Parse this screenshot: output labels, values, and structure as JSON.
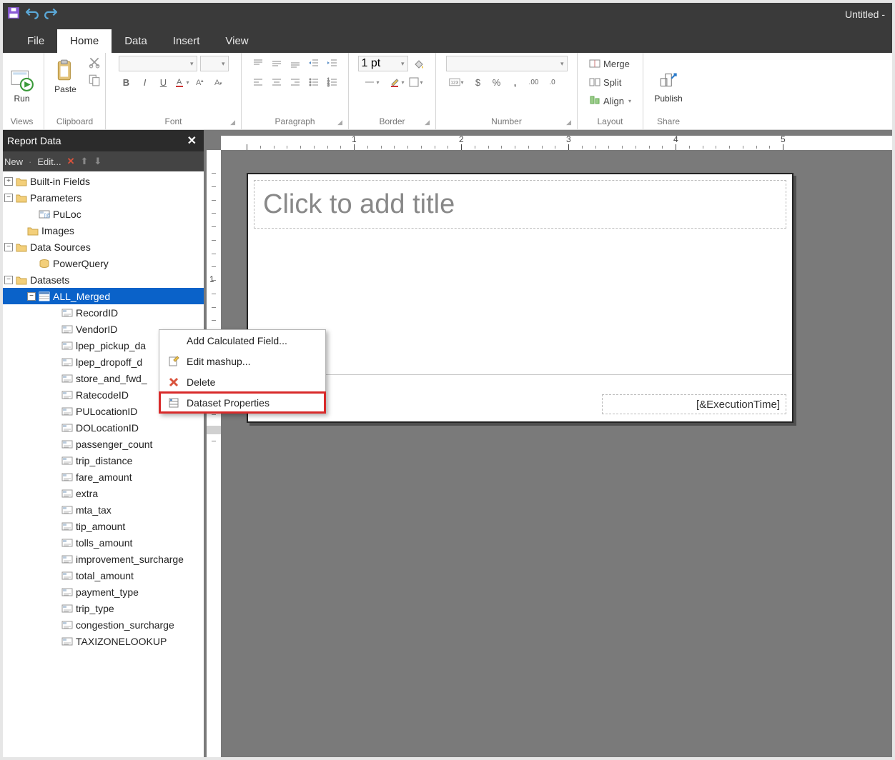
{
  "window": {
    "title": "Untitled -"
  },
  "qat": {
    "save": "save-icon",
    "undo": "undo-icon",
    "redo": "redo-icon"
  },
  "tabs": [
    "File",
    "Home",
    "Data",
    "Insert",
    "View"
  ],
  "active_tab_index": 1,
  "ribbon": {
    "views": {
      "run": "Run",
      "label": "Views"
    },
    "clipboard": {
      "paste": "Paste",
      "label": "Clipboard"
    },
    "font": {
      "label": "Font",
      "bold": "B",
      "italic": "I",
      "underline": "U",
      "font_combo": "",
      "size_combo": ""
    },
    "paragraph": {
      "label": "Paragraph"
    },
    "border": {
      "label": "Border",
      "weight": "1 pt"
    },
    "number": {
      "label": "Number",
      "format_combo": ""
    },
    "layout": {
      "label": "Layout",
      "merge": "Merge",
      "split": "Split",
      "align": "Align"
    },
    "share": {
      "label": "Share",
      "publish": "Publish"
    }
  },
  "panel": {
    "title": "Report Data",
    "toolbar": {
      "new": "New",
      "edit": "Edit..."
    },
    "tree": {
      "builtin": "Built-in Fields",
      "parameters": "Parameters",
      "param_items": [
        "PuLoc"
      ],
      "images": "Images",
      "datasources": "Data Sources",
      "ds_items": [
        "PowerQuery"
      ],
      "datasets": "Datasets",
      "dataset_name": "ALL_Merged",
      "fields": [
        "RecordID",
        "VendorID",
        "lpep_pickup_da",
        "lpep_dropoff_d",
        "store_and_fwd_",
        "RatecodeID",
        "PULocationID",
        "DOLocationID",
        "passenger_count",
        "trip_distance",
        "fare_amount",
        "extra",
        "mta_tax",
        "tip_amount",
        "tolls_amount",
        "improvement_surcharge",
        "total_amount",
        "payment_type",
        "trip_type",
        "congestion_surcharge",
        "TAXIZONELOOKUP"
      ]
    }
  },
  "canvas": {
    "title_placeholder": "Click to add title",
    "footer_expr": "[&ExecutionTime]",
    "hruler_numbers": [
      1,
      2,
      3,
      4,
      5
    ],
    "vruler_numbers": [
      1
    ]
  },
  "context_menu": {
    "items": [
      {
        "label": "Add Calculated Field...",
        "icon": ""
      },
      {
        "label": "Edit mashup...",
        "icon": "edit"
      },
      {
        "label": "Delete",
        "icon": "delete"
      },
      {
        "label": "Dataset Properties",
        "icon": "props",
        "highlighted": true
      }
    ]
  }
}
